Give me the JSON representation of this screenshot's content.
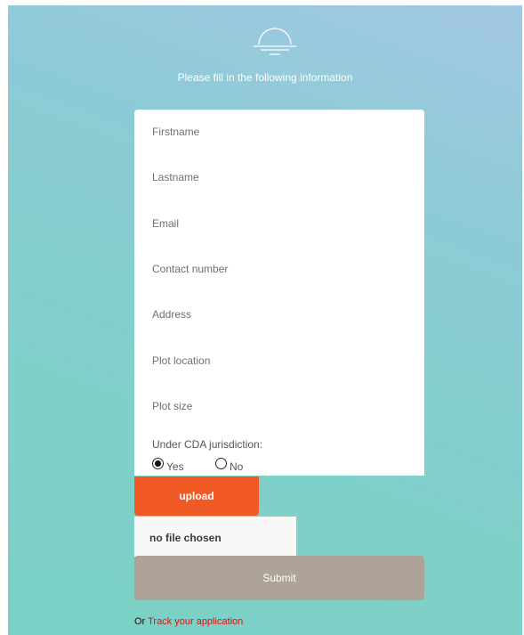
{
  "header": {
    "logo_icon": "sunset-icon",
    "subtitle": "Please fill in the following information"
  },
  "form": {
    "fields": [
      {
        "name": "firstname",
        "placeholder": "Firstname",
        "value": ""
      },
      {
        "name": "lastname",
        "placeholder": "Lastname",
        "value": ""
      },
      {
        "name": "email",
        "placeholder": "Email",
        "value": ""
      },
      {
        "name": "contact-number",
        "placeholder": "Contact number",
        "value": ""
      },
      {
        "name": "address",
        "placeholder": "Address",
        "value": ""
      },
      {
        "name": "plot-location",
        "placeholder": "Plot location",
        "value": ""
      },
      {
        "name": "plot-size",
        "placeholder": "Plot size",
        "value": ""
      }
    ],
    "cda_label": "Under CDA jurisdiction:",
    "cda_options": [
      {
        "label": "Yes",
        "selected": true
      },
      {
        "label": "No",
        "selected": false
      }
    ]
  },
  "upload": {
    "button_label": "upload",
    "file_status": "no file chosen"
  },
  "submit": {
    "label": "Submit"
  },
  "footer": {
    "or_text": "Or",
    "track_link": "Track your application"
  },
  "colors": {
    "background_from": "#a3c8e2",
    "background_to": "#7ad1c5",
    "upload_button": "#f15a24",
    "submit_button": "#ada396",
    "link": "#e01010"
  }
}
